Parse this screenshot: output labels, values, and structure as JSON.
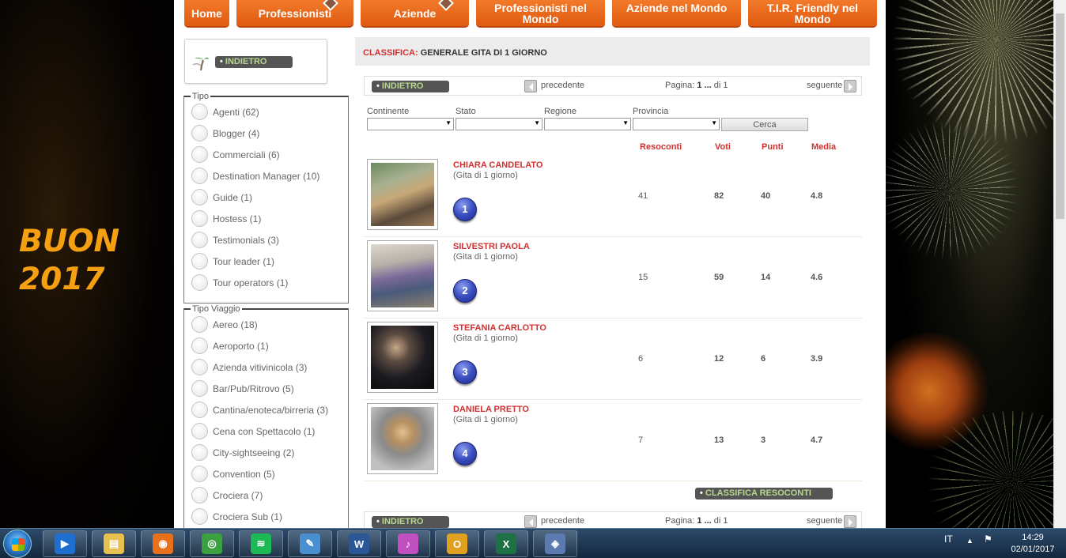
{
  "background": {
    "greeting_line1": "BUON",
    "greeting_line2": "2017"
  },
  "nav": {
    "home": "Home",
    "professionisti": "Professionisti",
    "aziende": "Aziende",
    "professionisti_mondo": "Professionisti nel Mondo",
    "aziende_mondo": "Aziende nel Mondo",
    "tir": "T.I.R. Friendly nel Mondo"
  },
  "sidebar": {
    "back_label": "INDIETRO",
    "tipo": {
      "legend": "Tipo",
      "items": [
        "Agenti (62)",
        "Blogger (4)",
        "Commerciali (6)",
        "Destination Manager (10)",
        "Guide (1)",
        "Hostess (1)",
        "Testimonials (3)",
        "Tour leader (1)",
        "Tour operators (1)"
      ]
    },
    "tipo_viaggio": {
      "legend": "Tipo Viaggio",
      "items": [
        "Aereo (18)",
        "Aeroporto (1)",
        "Azienda vitivinicola (3)",
        "Bar/Pub/Ritrovo (5)",
        "Cantina/enoteca/birreria (3)",
        "Cena con Spettacolo (1)",
        "City-sightseeing (2)",
        "Convention (5)",
        "Crociera (7)",
        "Crociera Sub (1)"
      ]
    }
  },
  "content": {
    "title_label": "CLASSIFICA:",
    "title_value": "GENERALE GITA DI 1 GIORNO",
    "pager": {
      "back_label": "INDIETRO",
      "prev_label": "precedente",
      "page_prefix": "Pagina:",
      "page_current": "1 ...",
      "page_suffix": "di 1",
      "next_label": "seguente"
    },
    "search": {
      "continente": "Continente",
      "stato": "Stato",
      "regione": "Regione",
      "provincia": "Provincia",
      "button": "Cerca"
    },
    "columns": {
      "resoconti": "Resoconti",
      "voti": "Voti",
      "punti": "Punti",
      "media": "Media"
    },
    "rows": [
      {
        "rank": "1",
        "name": "CHIARA CANDELATO",
        "sub": "(Gita di 1 giorno)",
        "resoconti": "41",
        "voti": "82",
        "punti": "40",
        "media": "4.8"
      },
      {
        "rank": "2",
        "name": "SILVESTRI PAOLA",
        "sub": "(Gita di 1 giorno)",
        "resoconti": "15",
        "voti": "59",
        "punti": "14",
        "media": "4.6"
      },
      {
        "rank": "3",
        "name": "STEFANIA CARLOTTO",
        "sub": "(Gita di 1 giorno)",
        "resoconti": "6",
        "voti": "12",
        "punti": "6",
        "media": "3.9"
      },
      {
        "rank": "4",
        "name": "DANIELA PRETTO",
        "sub": "(Gita di 1 giorno)",
        "resoconti": "7",
        "voti": "13",
        "punti": "3",
        "media": "4.7"
      }
    ],
    "classifica_button": "CLASSIFICA RESOCONTI"
  },
  "taskbar": {
    "apps": [
      "media-player",
      "file-explorer",
      "firefox",
      "chrome",
      "spotify",
      "feather-app",
      "word",
      "itunes",
      "outlook",
      "excel",
      "security-center"
    ],
    "language": "IT",
    "time": "14:29",
    "date": "02/01/2017"
  },
  "colors": {
    "nav_orange": "#e8631a",
    "accent_red": "#d03030",
    "greeting": "#f5a010"
  }
}
